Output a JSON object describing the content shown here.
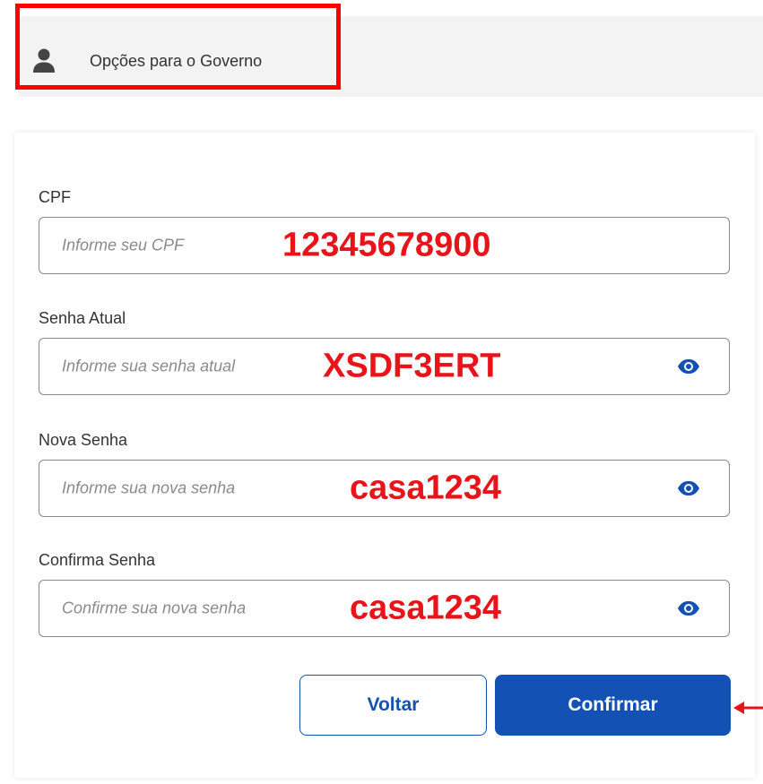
{
  "header": {
    "link_label": "Opções para o Governo",
    "icon": "user-icon"
  },
  "form": {
    "cpf": {
      "label": "CPF",
      "placeholder": "Informe seu CPF",
      "annotation": "12345678900"
    },
    "senha_atual": {
      "label": "Senha Atual",
      "placeholder": "Informe sua senha atual",
      "annotation": "XSDF3ERT"
    },
    "nova_senha": {
      "label": "Nova Senha",
      "placeholder": "Informe sua nova senha",
      "annotation": "casa1234"
    },
    "confirma_senha": {
      "label": "Confirma Senha",
      "placeholder": "Confirme sua nova senha",
      "annotation": "casa1234"
    }
  },
  "buttons": {
    "back": "Voltar",
    "confirm": "Confirmar"
  },
  "colors": {
    "primary": "#1351b4",
    "annotation_red": "#e8141a",
    "highlight_red": "#ff0000"
  }
}
